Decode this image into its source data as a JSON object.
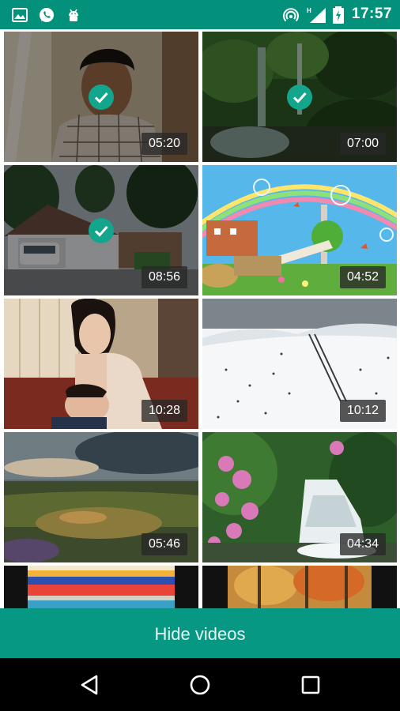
{
  "status_bar": {
    "time": "17:57",
    "left_icons": [
      "gallery-icon",
      "whatsapp-icon",
      "android-debug-icon"
    ],
    "right_icons": [
      "hotspot-icon",
      "signal-icon",
      "battery-charging-icon"
    ],
    "signal_label": "H",
    "background": "#03917c"
  },
  "videos": [
    {
      "duration": "05:20",
      "selected": true
    },
    {
      "duration": "07:00",
      "selected": true
    },
    {
      "duration": "08:56",
      "selected": true
    },
    {
      "duration": "04:52",
      "selected": false
    },
    {
      "duration": "10:28",
      "selected": false
    },
    {
      "duration": "10:12",
      "selected": false
    },
    {
      "duration": "05:46",
      "selected": false
    },
    {
      "duration": "04:34",
      "selected": false
    },
    {
      "duration": "",
      "selected": false
    },
    {
      "duration": "",
      "selected": false
    }
  ],
  "hide_button": {
    "label": "Hide videos",
    "color": "#079884"
  },
  "accent_check_color": "#14a68c",
  "nav": {
    "icons": [
      "back-icon",
      "home-icon",
      "recents-icon"
    ]
  }
}
